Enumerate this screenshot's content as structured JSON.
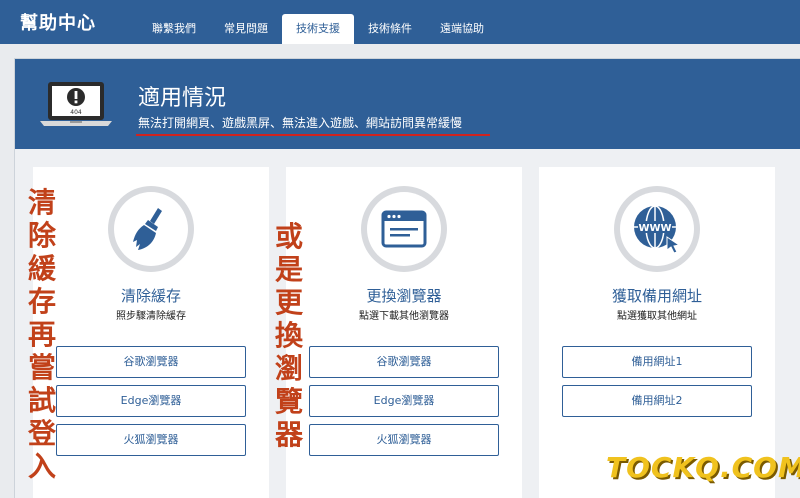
{
  "app": {
    "title": "幫助中心"
  },
  "nav": {
    "tabs": [
      {
        "label": "聯繫我們",
        "active": false
      },
      {
        "label": "常見問題",
        "active": false
      },
      {
        "label": "技術支援",
        "active": true
      },
      {
        "label": "技術條件",
        "active": false
      },
      {
        "label": "遠端協助",
        "active": false
      }
    ]
  },
  "banner": {
    "icon": "laptop-404-icon",
    "laptop_text": "404",
    "title": "適用情況",
    "subtitle": "無法打開網頁、遊戲黑屏、無法進入遊戲、網站訪問異常緩慢"
  },
  "cards": [
    {
      "icon": "broom-icon",
      "title": "清除緩存",
      "desc": "照步驟清除緩存",
      "buttons": [
        "谷歌瀏覽器",
        "Edge瀏覽器",
        "火狐瀏覽器"
      ]
    },
    {
      "icon": "browser-window-icon",
      "title": "更換瀏覽器",
      "desc": "點選下載其他瀏覽器",
      "buttons": [
        "谷歌瀏覽器",
        "Edge瀏覽器",
        "火狐瀏覽器"
      ]
    },
    {
      "icon": "globe-www-icon",
      "title": "獲取備用網址",
      "desc": "點選獲取其他網址",
      "buttons": [
        "備用網址1",
        "備用網址2"
      ]
    }
  ],
  "overlay": {
    "left_text": [
      "清",
      "除",
      "緩",
      "存",
      "再",
      "嘗",
      "試",
      "登",
      "入"
    ],
    "middle_text": [
      "或",
      "是",
      "更",
      "換",
      "瀏",
      "覽",
      "器"
    ],
    "watermark": "TOCKQ.COM"
  },
  "colors": {
    "primary": "#2f5f97",
    "accent_red": "#d0231f",
    "overlay_text": "#c1411a",
    "watermark": "#f0c21e"
  }
}
